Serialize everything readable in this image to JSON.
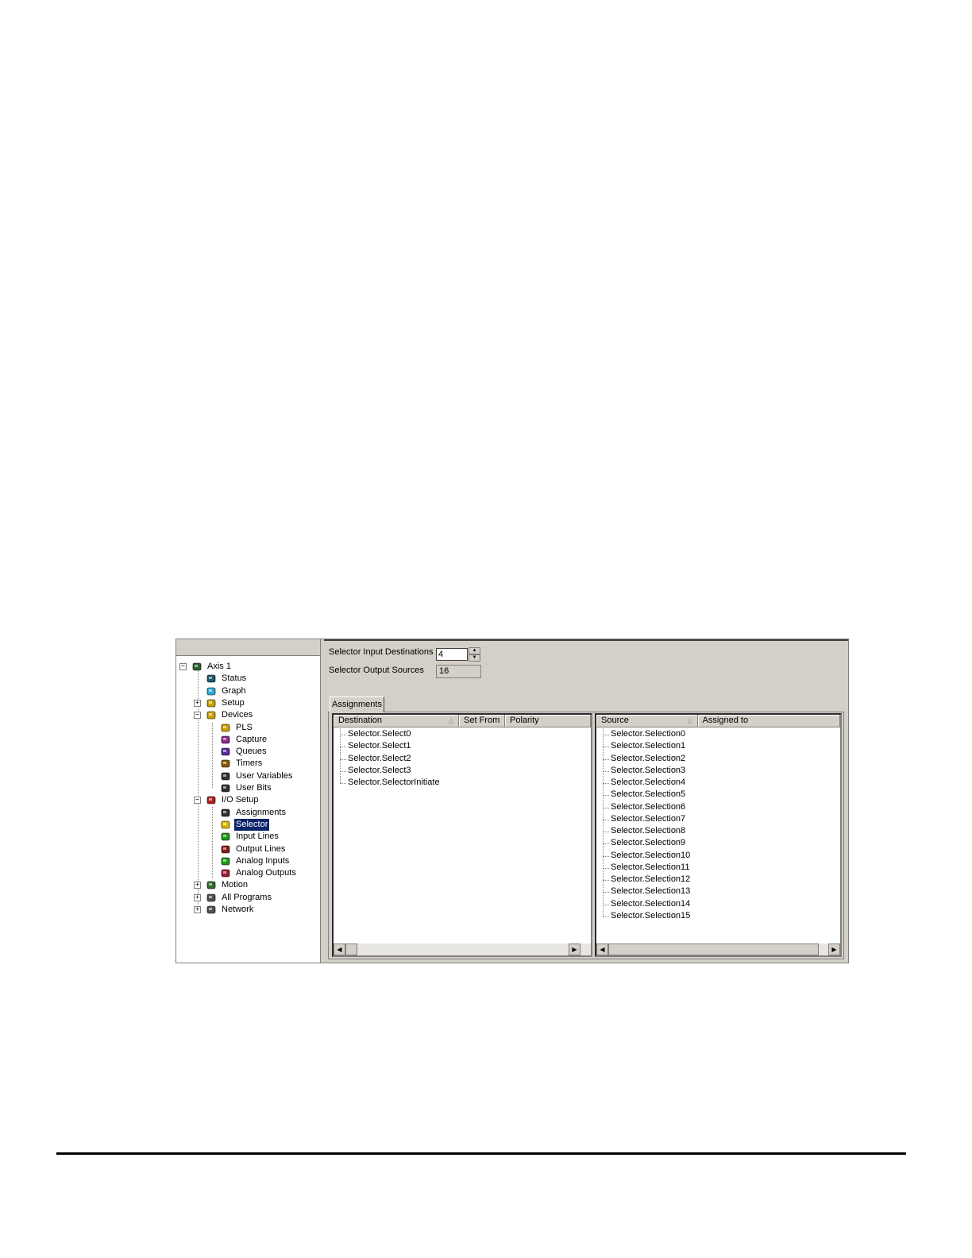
{
  "tree": {
    "items": [
      {
        "label": "Axis 1",
        "icon": "drive-icon",
        "expander": "−"
      },
      {
        "label": "Status",
        "icon": "status-icon"
      },
      {
        "label": "Graph",
        "icon": "graph-icon"
      },
      {
        "label": "Setup",
        "icon": "setup-icon",
        "expander": "+"
      },
      {
        "label": "Devices",
        "icon": "devices-icon",
        "expander": "−"
      },
      {
        "label": "PLS",
        "icon": "pls-icon"
      },
      {
        "label": "Capture",
        "icon": "clock-icon"
      },
      {
        "label": "Queues",
        "icon": "queues-icon"
      },
      {
        "label": "Timers",
        "icon": "hourglass-icon"
      },
      {
        "label": "User Variables",
        "icon": "user-variables-icon"
      },
      {
        "label": "User Bits",
        "icon": "user-bits-icon"
      },
      {
        "label": "I/O Setup",
        "icon": "io-setup-icon",
        "expander": "−"
      },
      {
        "label": "Assignments",
        "icon": "assignments-icon"
      },
      {
        "label": "Selector",
        "icon": "selector-icon"
      },
      {
        "label": "Input Lines",
        "icon": "input-lines-icon"
      },
      {
        "label": "Output Lines",
        "icon": "output-lines-icon"
      },
      {
        "label": "Analog Inputs",
        "icon": "analog-inputs-icon"
      },
      {
        "label": "Analog Outputs",
        "icon": "analog-outputs-icon"
      },
      {
        "label": "Motion",
        "icon": "motion-icon",
        "expander": "+"
      },
      {
        "label": "All Programs",
        "icon": "programs-icon",
        "expander": "+"
      },
      {
        "label": "Network",
        "icon": "network-icon",
        "expander": "+"
      }
    ]
  },
  "config": {
    "input_destinations_label": "Selector Input Destinations",
    "input_destinations_value": "4",
    "output_sources_label": "Selector Output Sources",
    "output_sources_value": "16"
  },
  "tabs": [
    "Assignments"
  ],
  "destinations": {
    "columns": [
      "Destination",
      "Set From",
      "Polarity"
    ],
    "rows": [
      "Selector.Select0",
      "Selector.Select1",
      "Selector.Select2",
      "Selector.Select3",
      "Selector.SelectorInitiate"
    ]
  },
  "sources": {
    "columns": [
      "Source",
      "Assigned to"
    ],
    "rows": [
      "Selector.Selection0",
      "Selector.Selection1",
      "Selector.Selection2",
      "Selector.Selection3",
      "Selector.Selection4",
      "Selector.Selection5",
      "Selector.Selection6",
      "Selector.Selection7",
      "Selector.Selection8",
      "Selector.Selection9",
      "Selector.Selection10",
      "Selector.Selection11",
      "Selector.Selection12",
      "Selector.Selection13",
      "Selector.Selection14",
      "Selector.Selection15"
    ]
  },
  "icons": {
    "scroll_left": "◀",
    "scroll_right": "▶",
    "spin_up": "▲",
    "spin_down": "▼",
    "sort": "△"
  },
  "colors": {
    "selection": "#0a246a",
    "window_face": "#d4d0c8"
  }
}
